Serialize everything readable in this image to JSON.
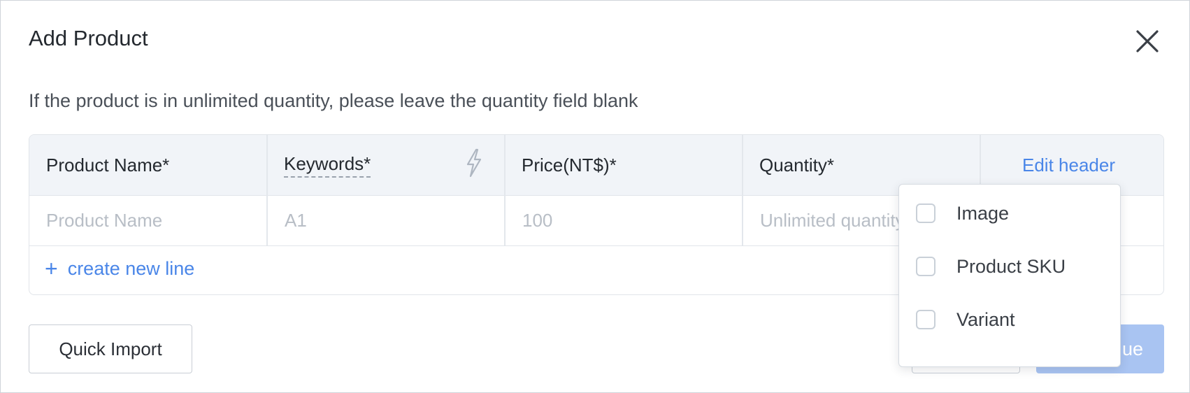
{
  "dialog": {
    "title": "Add Product",
    "hint": "If the product is in unlimited quantity, please leave the quantity field blank"
  },
  "table": {
    "headers": {
      "product_name": "Product Name*",
      "keywords": "Keywords*",
      "price": "Price(NT$)*",
      "quantity": "Quantity*",
      "edit_header": "Edit header"
    },
    "row_placeholders": {
      "product_name": "Product Name",
      "keywords": "A1",
      "price": "100",
      "quantity": "Unlimited quantity"
    },
    "add_line_label": "create new line"
  },
  "footer": {
    "quick_import_label": "Quick Import",
    "continue_label_visible": "ue"
  },
  "header_menu": {
    "options": [
      {
        "label": "Image",
        "checked": false
      },
      {
        "label": "Product SKU",
        "checked": false
      },
      {
        "label": "Variant",
        "checked": false
      }
    ]
  },
  "colors": {
    "accent": "#4a86e8",
    "disabled_primary": "#a9c4f2",
    "table_header_bg": "#f1f4f8"
  }
}
